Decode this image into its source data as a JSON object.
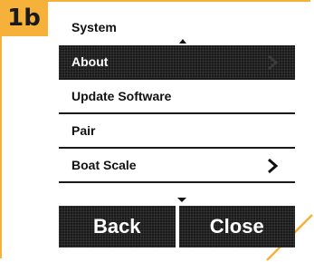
{
  "step": {
    "label": "1b"
  },
  "screen": {
    "title": "System",
    "menu": [
      {
        "label": "About",
        "selected": true,
        "has_chevron": true
      },
      {
        "label": "Update Software",
        "selected": false,
        "has_chevron": false
      },
      {
        "label": "Pair",
        "selected": false,
        "has_chevron": false
      },
      {
        "label": "Boat Scale",
        "selected": false,
        "has_chevron": true
      }
    ],
    "buttons": {
      "back": "Back",
      "close": "Close"
    }
  },
  "icons": {
    "scroll_up": "triangle-up-icon",
    "scroll_down": "triangle-down-icon",
    "chevron": "chevron-right-icon"
  },
  "colors": {
    "accent": "#f5b13a",
    "dark": "#1a1a1a",
    "background": "#ffffff"
  }
}
